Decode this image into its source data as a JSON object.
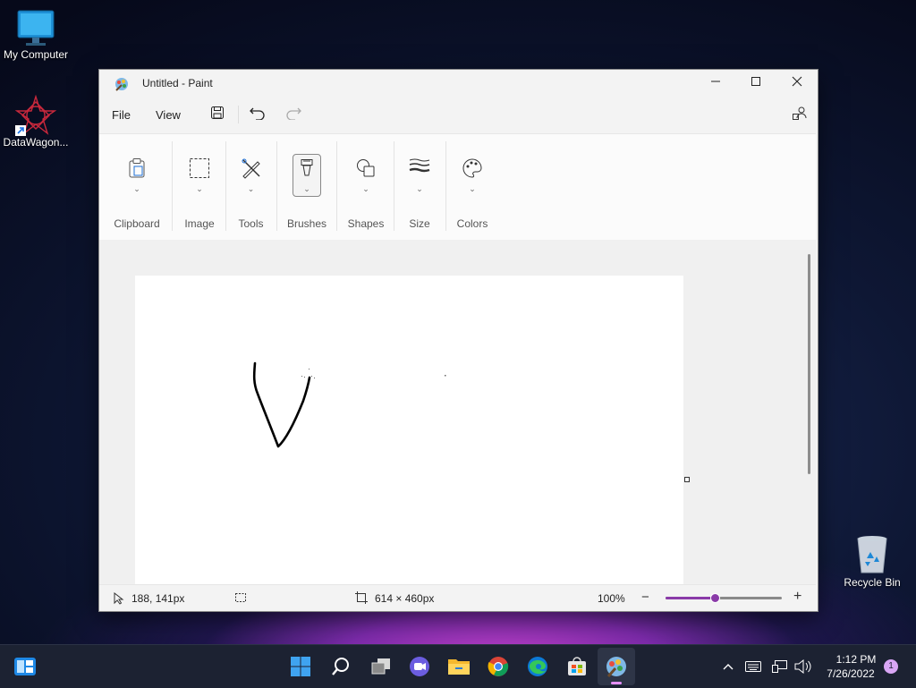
{
  "desktop": {
    "icons": [
      {
        "label": "My Computer",
        "icon": "monitor-icon"
      },
      {
        "label": "DataWagon...",
        "icon": "datawagon-icon"
      },
      {
        "label": "Recycle Bin",
        "icon": "recycle-bin-icon"
      }
    ]
  },
  "window": {
    "title": "Untitled - Paint",
    "controls": {
      "minimize": "minimize-icon",
      "maximize": "maximize-icon",
      "close": "close-icon"
    }
  },
  "menubar": {
    "file": "File",
    "view": "View",
    "icons": [
      "save-icon",
      "undo-icon",
      "redo-icon",
      "account-icon"
    ]
  },
  "ribbon": {
    "groups": [
      {
        "label": "Clipboard",
        "icon": "clipboard-icon"
      },
      {
        "label": "Image",
        "icon": "selection-icon"
      },
      {
        "label": "Tools",
        "icon": "tools-icon"
      },
      {
        "label": "Brushes",
        "icon": "brush-icon"
      },
      {
        "label": "Shapes",
        "icon": "shapes-icon"
      },
      {
        "label": "Size",
        "icon": "size-icon"
      },
      {
        "label": "Colors",
        "icon": "palette-icon"
      }
    ]
  },
  "statusbar": {
    "cursor_pos": "188, 141px",
    "canvas_size": "614 × 460px",
    "zoom": "100%",
    "zoom_fraction": 0.42
  },
  "taskbar": {
    "apps": [
      "widgets-icon",
      "start-icon",
      "search-icon",
      "task-view-icon",
      "chat-icon",
      "file-explorer-icon",
      "chrome-icon",
      "edge-icon",
      "store-icon",
      "paint-icon"
    ],
    "time": "1:12 PM",
    "date": "7/26/2022",
    "notification_count": "1"
  },
  "colors": {
    "accent": "#8a3aa8"
  }
}
